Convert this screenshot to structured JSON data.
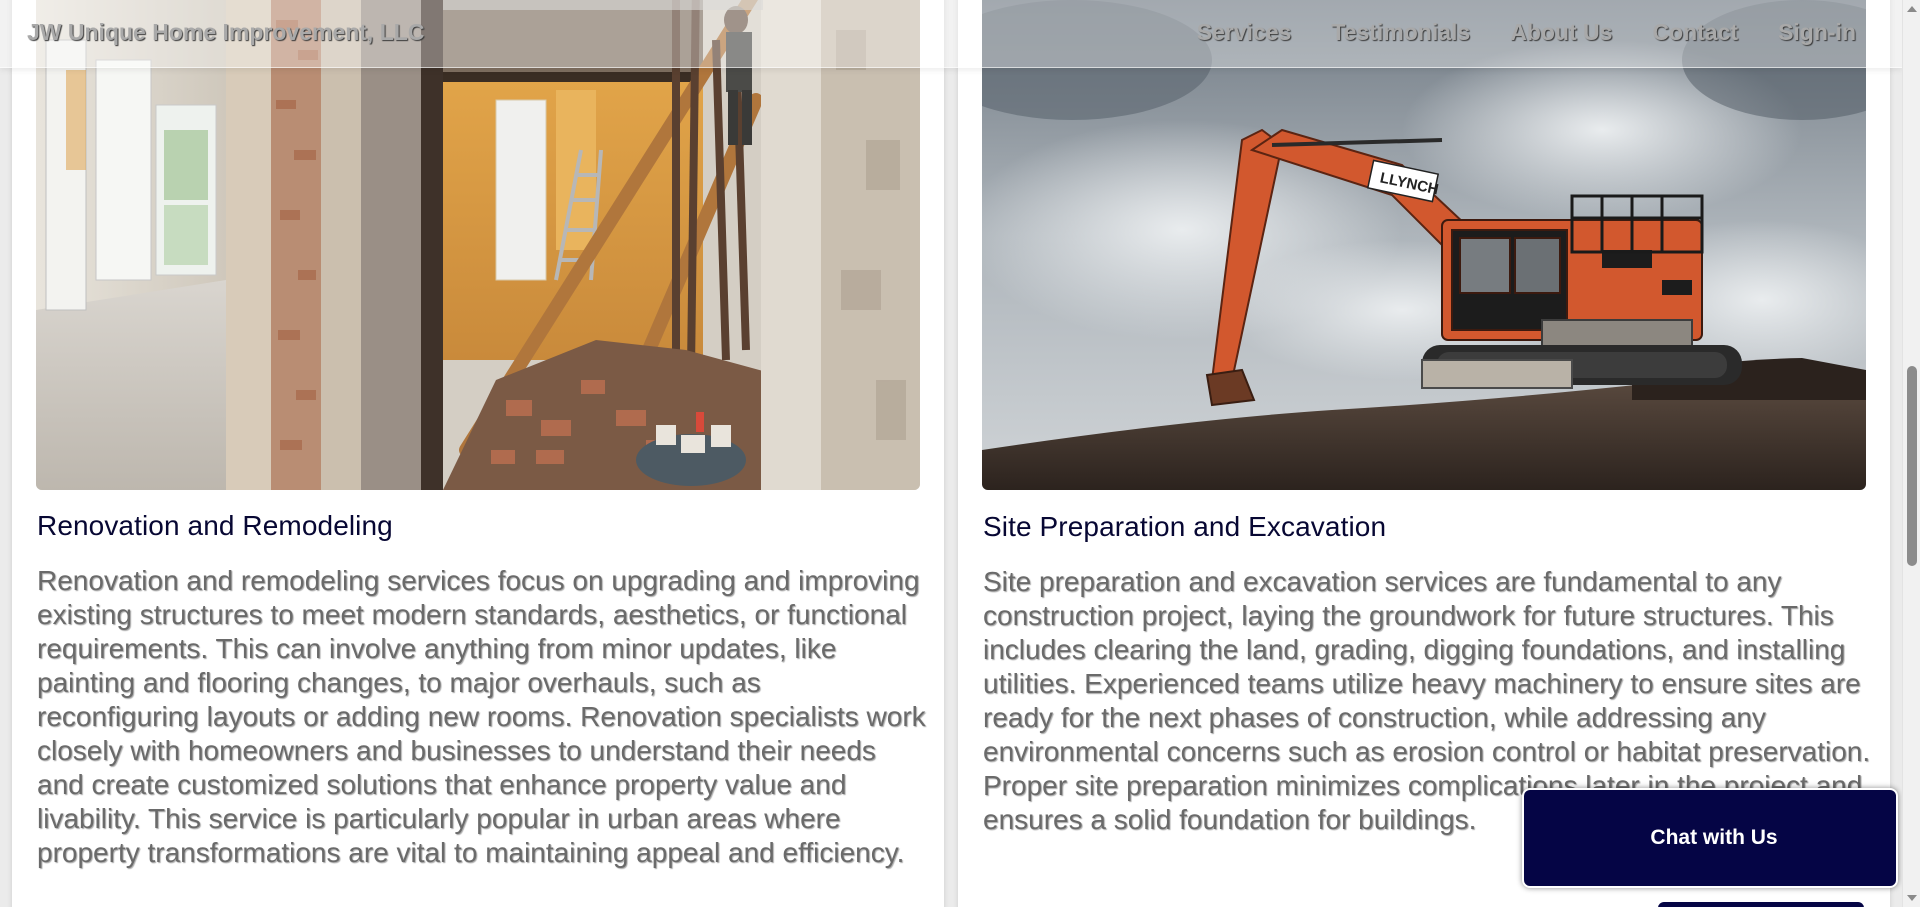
{
  "navbar": {
    "brand": "JW Unique Home Improvement, LLC",
    "links": [
      "Services",
      "Testimonials",
      "About Us",
      "Contact",
      "Sign-in"
    ]
  },
  "services": [
    {
      "title": "Renovation and Remodeling",
      "image_alt": "renovation-interior-photo",
      "description": "Renovation and remodeling services focus on upgrading and improving existing structures to meet modern standards, aesthetics, or functional requirements. This can involve anything from minor updates, like painting and flooring changes, to major overhauls, such as reconfiguring layouts or adding new rooms. Renovation specialists work closely with homeowners and businesses to understand their needs and create customized solutions that enhance property value and livability. This service is particularly popular in urban areas where property transformations are vital to maintaining appeal and efficiency."
    },
    {
      "title": "Site Preparation and Excavation",
      "image_alt": "excavator-photo",
      "image_label": "LLYNCH",
      "description": "Site preparation and excavation services are fundamental to any construction project, laying the groundwork for future structures. This includes clearing the land, grading, digging foundations, and installing utilities. Experienced teams utilize heavy machinery to ensure sites are ready for the next phases of construction, while addressing any environmental concerns such as erosion control or habitat preservation. Proper site preparation minimizes complications later in the project and ensures a solid foundation for buildings."
    }
  ],
  "chat": {
    "label": "Chat with Us"
  },
  "colors": {
    "title": "#070733",
    "body_text": "#6a6a6a",
    "chat_bg": "#050545",
    "excavator": "#d2582e"
  }
}
